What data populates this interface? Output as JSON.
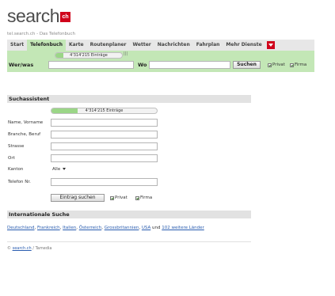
{
  "logo": {
    "text": "search",
    "badge": "ch"
  },
  "subtitle": "tel.search.ch - Das Telefonbuch",
  "tabs": [
    {
      "label": "Start"
    },
    {
      "label": "Telefonbuch"
    },
    {
      "label": "Karte"
    },
    {
      "label": "Routenplaner"
    },
    {
      "label": "Wetter"
    },
    {
      "label": "Nachrichten"
    },
    {
      "label": "Fahrplan"
    },
    {
      "label": "Mehr Dienste"
    }
  ],
  "searchbar": {
    "count": "4'314'215 Einträge",
    "count_fill_fraction": 0.12,
    "count_ext": "|||",
    "wer_label": "Wer/was",
    "wo_label": "Wo",
    "search_button": "Suchen",
    "privat_label": "Privat",
    "firma_label": "Firma"
  },
  "assistant": {
    "title": "Suchassistent",
    "count": "4'314'215 Einträge",
    "count_fill_fraction": 0.25,
    "fields": [
      {
        "label": "Name, Vorname"
      },
      {
        "label": "Branche, Beruf"
      },
      {
        "label": "Strasse"
      },
      {
        "label": "Ort"
      }
    ],
    "kanton_label": "Kanton",
    "kanton_value": "Alle",
    "telefon_label": "Telefon Nr.",
    "submit_button": "Eintrag suchen",
    "privat_label": "Privat",
    "firma_label": "Firma"
  },
  "international": {
    "title": "Internationale Suche",
    "links": [
      "Deutschland",
      "Frankreich",
      "Italien",
      "Österreich",
      "Grossbritannien",
      "USA"
    ],
    "and_text": "und",
    "more_link": "102 weitere Länder"
  },
  "footer": {
    "prefix": "© ",
    "link": "search.ch",
    "suffix": " / Tamedia"
  },
  "colors": {
    "accent_green": "#c3e7b6",
    "brand_red": "#d0021b",
    "link_blue": "#2a5db0"
  }
}
